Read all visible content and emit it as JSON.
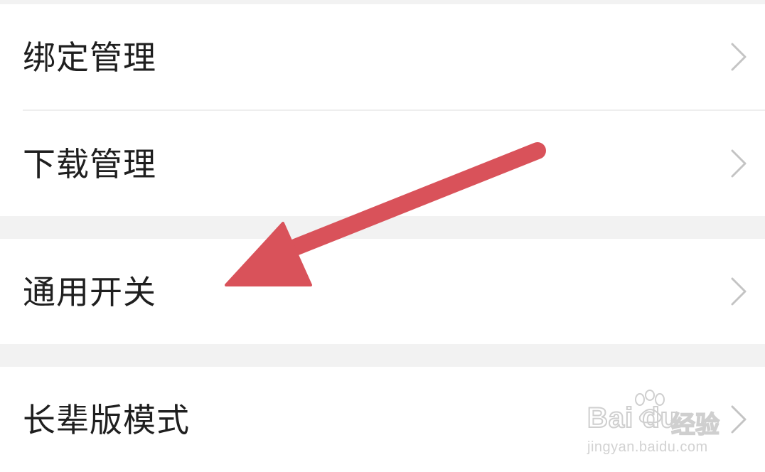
{
  "menu": {
    "items": [
      {
        "label": "绑定管理",
        "chevron_icon": "chevron-right-icon"
      },
      {
        "label": "下载管理",
        "chevron_icon": "chevron-right-icon"
      },
      {
        "label": "通用开关",
        "chevron_icon": "chevron-right-icon"
      },
      {
        "label": "长辈版模式",
        "chevron_icon": "chevron-right-icon"
      }
    ]
  },
  "annotation": {
    "icon": "arrow-pointer-icon",
    "color": "#d9525a"
  },
  "watermark": {
    "brand": "Bai du",
    "product": "经验",
    "url": "jingyan.baidu.com"
  },
  "colors": {
    "background": "#ffffff",
    "section_gap": "#f2f2f2",
    "divider": "#eeeeee",
    "text": "#1f1f1f",
    "chevron": "#c4c4c4"
  }
}
